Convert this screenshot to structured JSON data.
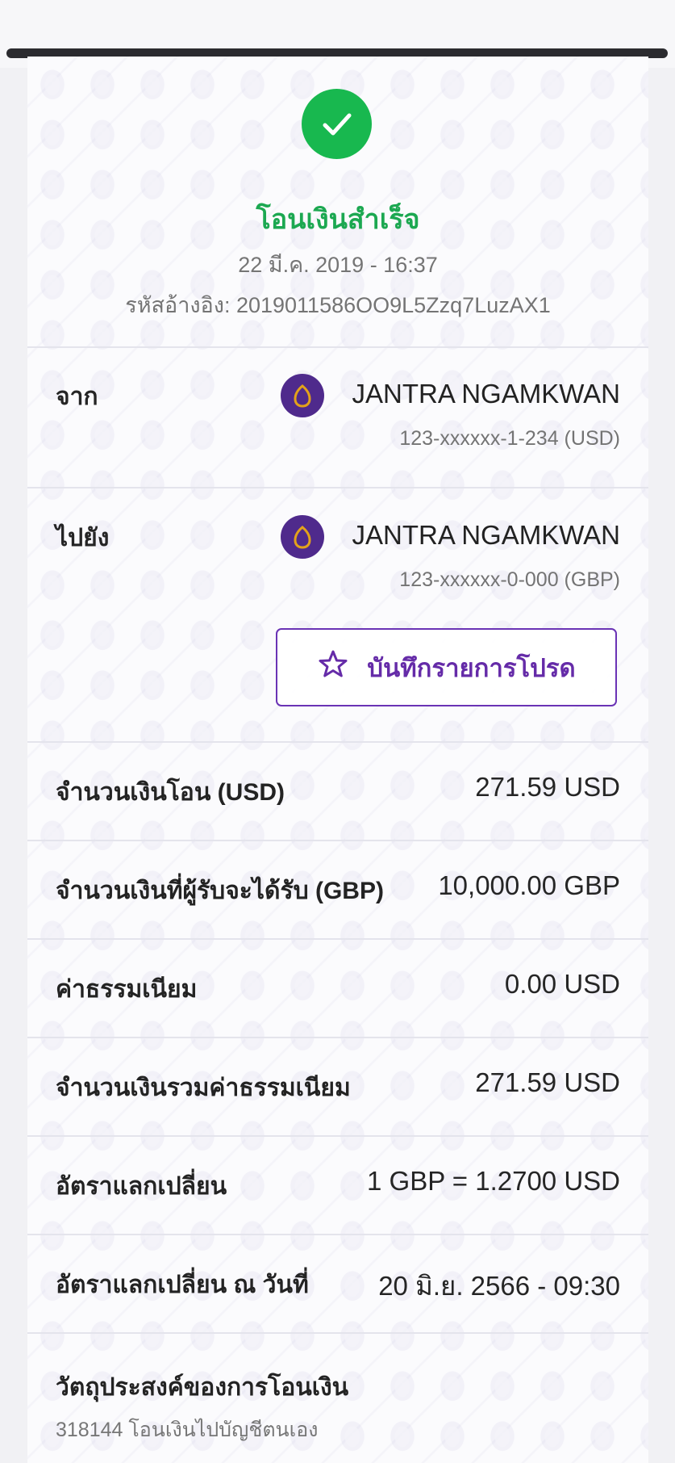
{
  "receipt": {
    "title": "โอนเงินสำเร็จ",
    "date_time": "22 มี.ค. 2019 - 16:37",
    "reference": "รหัสอ้างอิง: 2019011586OO9L5Zzq7LuzAX1"
  },
  "from": {
    "label": "จาก",
    "name": "JANTRA NGAMKWAN",
    "account_number": "123-xxxxxx-1-234 (USD)",
    "logo_icon": "bank-logo-icon"
  },
  "to": {
    "label": "ไปยัง",
    "name": "JANTRA NGAMKWAN",
    "account_number": "123-xxxxxx-0-000 (GBP)",
    "logo_icon": "bank-logo-icon"
  },
  "favorite_button": {
    "label": "บันทึกรายการโปรด",
    "icon": "star-outline-icon"
  },
  "details": [
    {
      "label": "จำนวนเงินโอน (USD)",
      "value": "271.59 USD"
    },
    {
      "label": "จำนวนเงินที่ผู้รับจะได้รับ (GBP)",
      "value": "10,000.00 GBP"
    },
    {
      "label": "ค่าธรรมเนียม",
      "value": "0.00 USD"
    },
    {
      "label": "จำนวนเงินรวมค่าธรรมเนียม",
      "value": "271.59 USD"
    },
    {
      "label": "อัตราแลกเปลี่ยน",
      "value": "1 GBP = 1.2700 USD"
    },
    {
      "label": "อัตราแลกเปลี่ยน ณ วันที่",
      "value": "20 มิ.ย. 2566 - 09:30"
    }
  ],
  "purpose": {
    "label": "วัตถุประสงค์ของการโอนเงิน",
    "value": "318144 โอนเงินไปบัญชีตนเอง"
  },
  "colors": {
    "success": "#18b84f",
    "brand_purple": "#4f2a8c",
    "accent_purple": "#652ba8",
    "gold": "#e3a21a"
  }
}
